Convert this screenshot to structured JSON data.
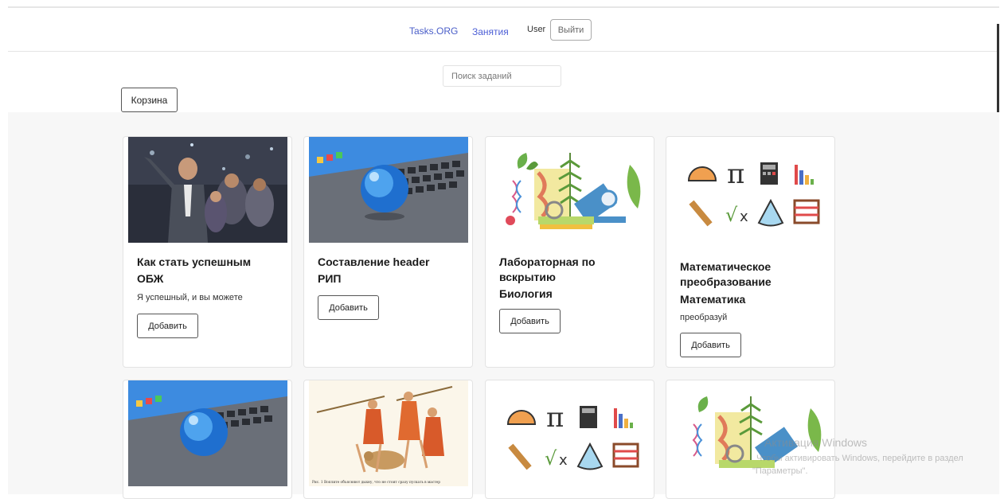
{
  "nav": {
    "brand": "Tasks.ORG",
    "link_lessons": "Занятия",
    "user": "User",
    "logout": "Выйти"
  },
  "search": {
    "placeholder": "Поиск заданий"
  },
  "cart": {
    "label": "Корзина"
  },
  "cards": [
    {
      "title": "Как стать успешным",
      "subject": "ОБЖ",
      "desc": "Я успешный, и вы можете",
      "add": "Добавить",
      "image": "business-speaker-photo"
    },
    {
      "title": "Составление header",
      "subject": "РИП",
      "desc": "",
      "add": "Добавить",
      "image": "laptop-globe-photo"
    },
    {
      "title": "Лабораторная по вскрытию",
      "subject": "Биология",
      "desc": "",
      "add": "Добавить",
      "image": "biology-lab-illustration"
    },
    {
      "title": "Математическое преобразование",
      "subject": "Математика",
      "desc": "преобразуй",
      "add": "Добавить",
      "image": "math-icons-illustration"
    },
    {
      "image": "laptop-globe-photo"
    },
    {
      "image": "ancient-warriors-illustration",
      "caption": "Рис. 1 Воплите объясняют дыхну, что не стоит сразу пускать в мастер"
    },
    {
      "image": "math-icons-illustration"
    },
    {
      "image": "biology-lab-illustration"
    }
  ],
  "watermark": {
    "line1": "Активация Windows",
    "line2": "Чтобы активировать Windows, перейдите в раздел",
    "line3": "\"Параметры\"."
  }
}
